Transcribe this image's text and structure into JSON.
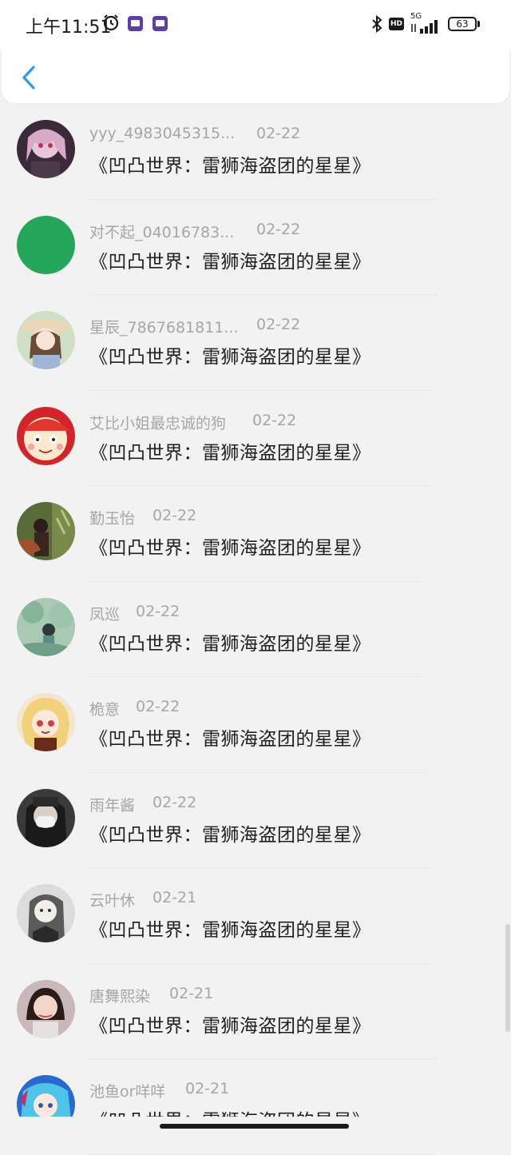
{
  "status_bar": {
    "time": "上午11:51",
    "network": "5G",
    "hd": "HD",
    "battery": "63"
  },
  "header": {
    "back_icon": "chevron-left-icon",
    "accent_color": "#2b9af3"
  },
  "items": [
    {
      "name": "yyy_4983045315...",
      "date": "02-22",
      "title": "《凹凸世界：雷狮海盗团的星星》",
      "avatar": "anime-pink-girl"
    },
    {
      "name": "对不起_04016783...",
      "date": "02-22",
      "title": "《凹凸世界：雷狮海盗团的星星》",
      "avatar": "solid-green",
      "avatar_color": "#24a75b"
    },
    {
      "name": "星辰_7867681811...",
      "date": "02-22",
      "title": "《凹凸世界：雷狮海盗团的星星》",
      "avatar": "anime-girl-hat"
    },
    {
      "name": "艾比小姐最忠诚的狗",
      "date": "02-22",
      "title": "《凹凸世界：雷狮海盗团的星星》",
      "avatar": "cartoon-face-red"
    },
    {
      "name": "勤玉怡",
      "date": "02-22",
      "title": "《凹凸世界：雷狮海盗团的星星》",
      "avatar": "photo-girl-plants"
    },
    {
      "name": "凤巡",
      "date": "02-22",
      "title": "《凹凸世界：雷狮海盗团的星星》",
      "avatar": "illustration-green"
    },
    {
      "name": "桅意",
      "date": "02-22",
      "title": "《凹凸世界：雷狮海盗团的星星》",
      "avatar": "anime-blonde-girl"
    },
    {
      "name": "雨年酱",
      "date": "02-22",
      "title": "《凹凸世界：雷狮海盗团的星星》",
      "avatar": "photo-mask-girl"
    },
    {
      "name": "云叶休",
      "date": "02-21",
      "title": "《凹凸世界：雷狮海盗团的星星》",
      "avatar": "sketch-girl"
    },
    {
      "name": "唐舞熙染",
      "date": "02-21",
      "title": "《凹凸世界：雷狮海盗团的星星》",
      "avatar": "photo-child"
    },
    {
      "name": "池鱼or咩咩",
      "date": "02-21",
      "title": "《凹凸世界：雷狮海盗团的星星》",
      "avatar": "anime-blue-hair"
    }
  ]
}
